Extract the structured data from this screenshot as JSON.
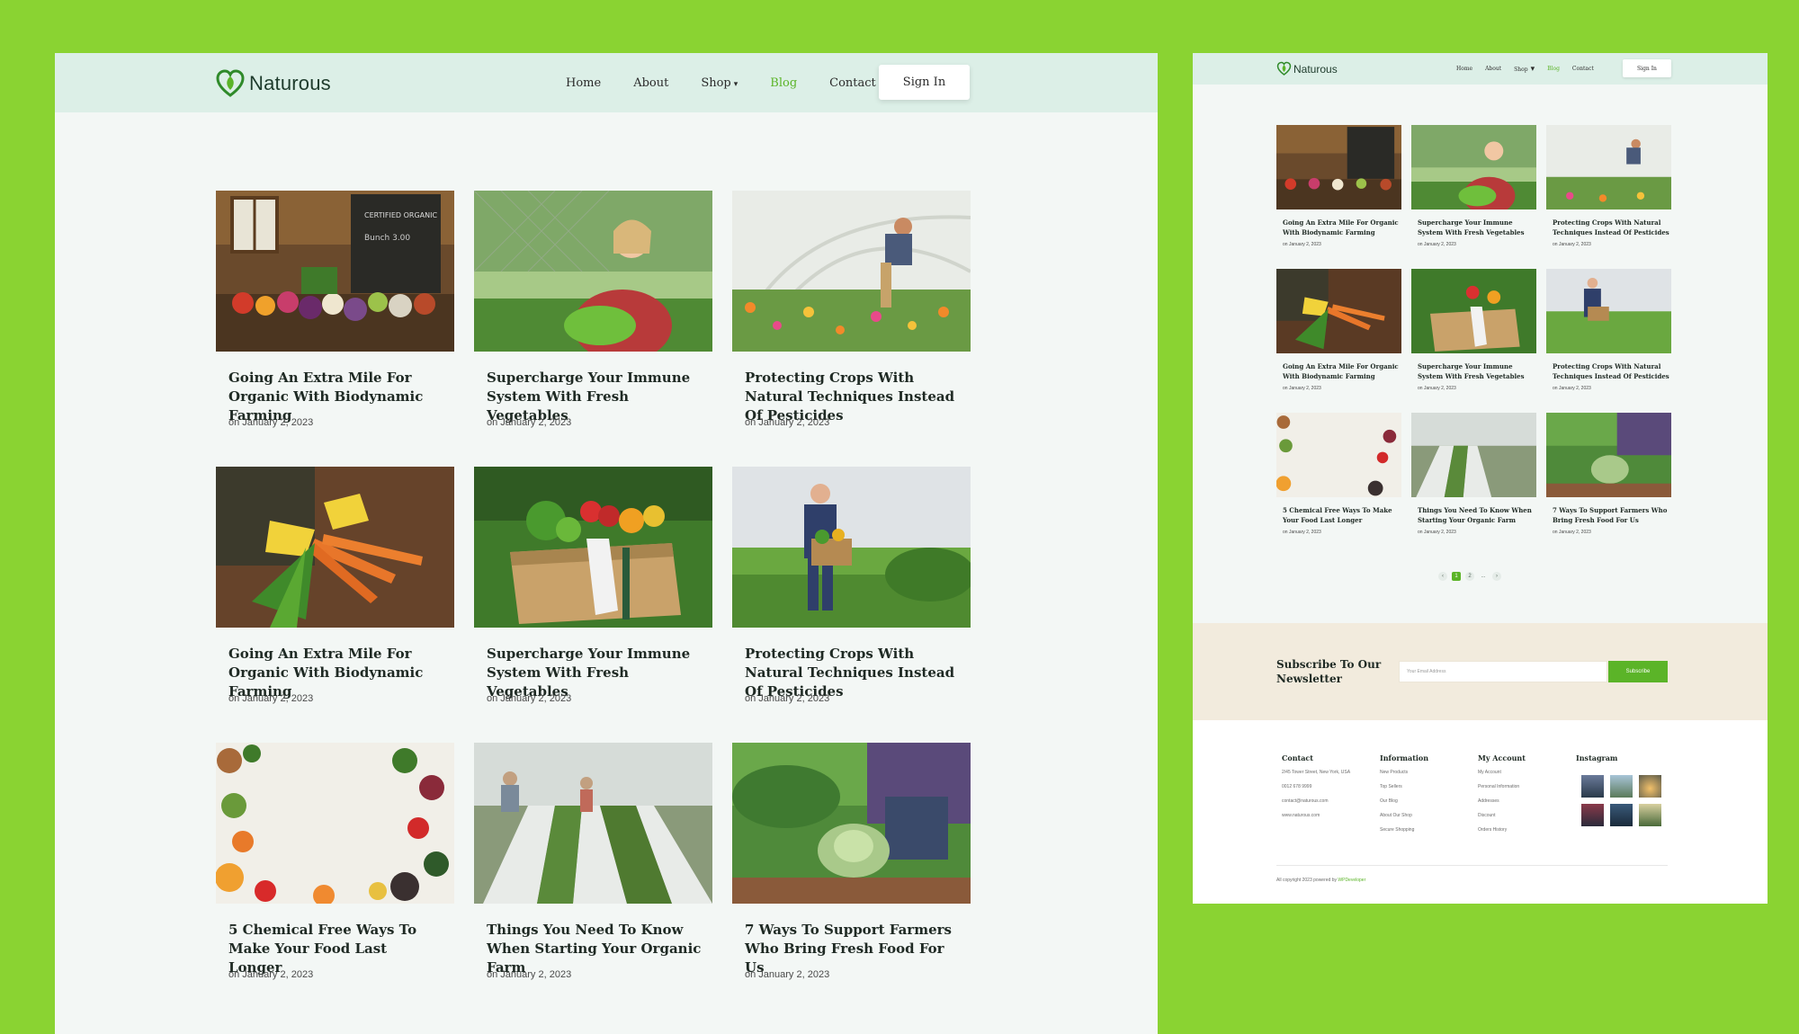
{
  "brand": {
    "name": "Naturous",
    "accent": "#5bb428",
    "background": "#8ad332"
  },
  "nav": {
    "items": [
      "Home",
      "About",
      "Shop",
      "Blog",
      "Contact"
    ],
    "active": "Blog",
    "signin": "Sign In"
  },
  "posts": [
    {
      "title": "Going An Extra Mile For Organic With Biodynamic Farming",
      "date": "on January 2, 2023",
      "image": "market-stall"
    },
    {
      "title": "Supercharge Your Immune System With Fresh Vegetables",
      "date": "on January 2, 2023",
      "image": "woman-with-lettuce"
    },
    {
      "title": "Protecting Crops With Natural Techniques Instead Of Pesticides",
      "date": "on January 2, 2023",
      "image": "greenhouse-flowers"
    },
    {
      "title": "Going An Extra Mile For Organic With Biodynamic Farming",
      "date": "on January 2, 2023",
      "image": "carrots-in-hands"
    },
    {
      "title": "Supercharge Your Immune System With Fresh Vegetables",
      "date": "on January 2, 2023",
      "image": "vegetable-crate"
    },
    {
      "title": "Protecting Crops With Natural Techniques Instead Of Pesticides",
      "date": "on January 2, 2023",
      "image": "farmer-with-box"
    },
    {
      "title": "5 Chemical Free Ways To Make Your Food Last Longer",
      "date": "on January 2, 2023",
      "image": "food-flatlay"
    },
    {
      "title": "Things You Need To Know When Starting Your Organic Farm",
      "date": "on January 2, 2023",
      "image": "greenhouse-rows"
    },
    {
      "title": "7 Ways To Support Farmers Who Bring Fresh Food For Us",
      "date": "on January 2, 2023",
      "image": "woman-with-cabbage"
    }
  ],
  "pagination": {
    "prev": "‹",
    "pages": [
      "1",
      "2"
    ],
    "current": "1",
    "ellipsis": "...",
    "next": "›"
  },
  "newsletter": {
    "title": "Subscribe To Our Newsletter",
    "placeholder": "Your Email Address",
    "button": "Subscribe"
  },
  "footer": {
    "contact": {
      "heading": "Contact",
      "lines": [
        "2/45 Tower Street, New York, USA",
        "0012 678 9999",
        "contact@naturous.com",
        "www.naturous.com"
      ]
    },
    "information": {
      "heading": "Information",
      "links": [
        "New Products",
        "Top Sellers",
        "Our Blog",
        "About Our Shop",
        "Secure Shopping"
      ]
    },
    "account": {
      "heading": "My Account",
      "links": [
        "My Account",
        "Personal Information",
        "Addresses",
        "Discount",
        "Orders History"
      ]
    },
    "instagram": {
      "heading": "Instagram"
    },
    "copyright": "All copyright 2023 powered by",
    "copyright_link": "WPDeveloper"
  }
}
